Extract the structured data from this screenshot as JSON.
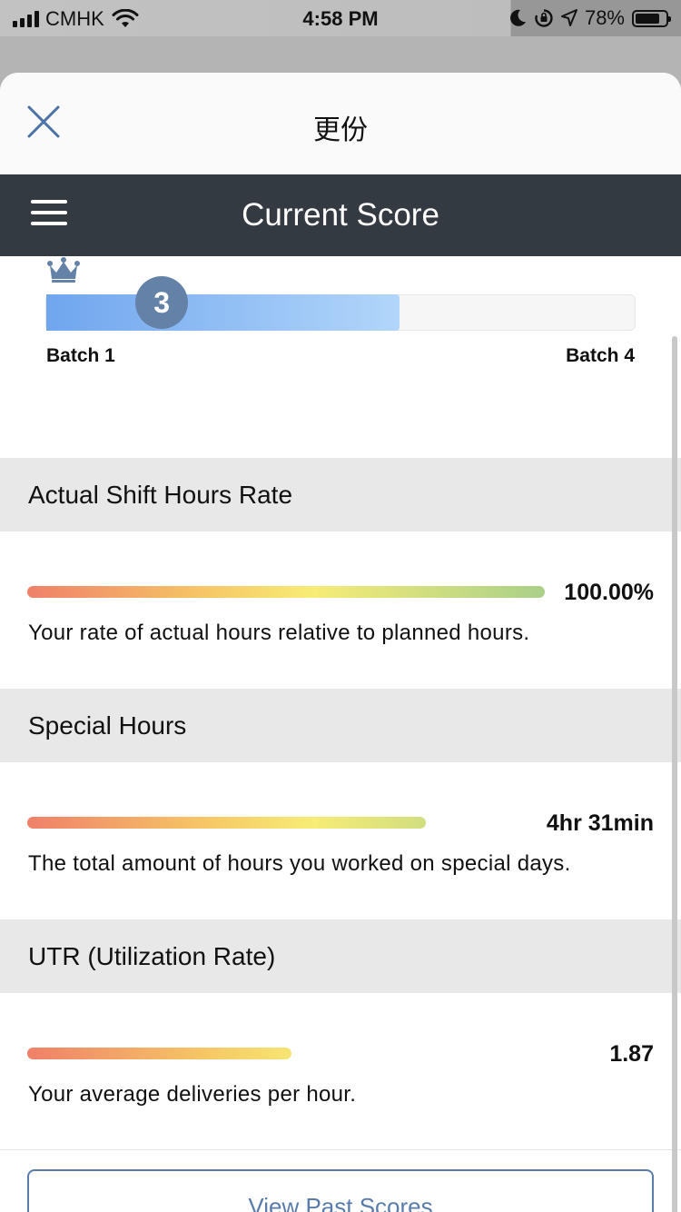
{
  "status_bar": {
    "carrier": "CMHK",
    "time": "4:58 PM",
    "battery": "78%",
    "battery_level": 0.78,
    "icons": [
      "signal-icon",
      "wifi-icon",
      "moon-icon",
      "rotation-lock-icon",
      "location-icon",
      "battery-icon"
    ]
  },
  "sheet": {
    "title": "更份",
    "close_icon": "close-icon"
  },
  "navbar": {
    "title": "Current Score",
    "menu_icon": "menu-icon"
  },
  "batch": {
    "crown_icon": "crown-icon",
    "current": "3",
    "progress": 0.6,
    "left_label": "Batch 1",
    "right_label": "Batch 4",
    "colors": {
      "fill_start": "#6fa6ee",
      "fill_end": "#b2d6fa",
      "badge": "#6481a8"
    }
  },
  "metrics": [
    {
      "title": "Actual Shift Hours Rate",
      "value": "100.00%",
      "description": "Your rate of actual hours relative to planned hours.",
      "level": 1.0
    },
    {
      "title": "Special Hours",
      "value": "4hr 31min",
      "description": "The total amount of hours you worked on special days.",
      "level": 0.77
    },
    {
      "title": "UTR (Utilization Rate)",
      "value": "1.87",
      "description": "Your average deliveries per hour.",
      "level": 0.51
    }
  ],
  "bar_gradient": [
    "#ef8069",
    "#f6c866",
    "#f7ec76",
    "#a9d089"
  ],
  "footer": {
    "past_scores_label": "View Past Scores"
  }
}
